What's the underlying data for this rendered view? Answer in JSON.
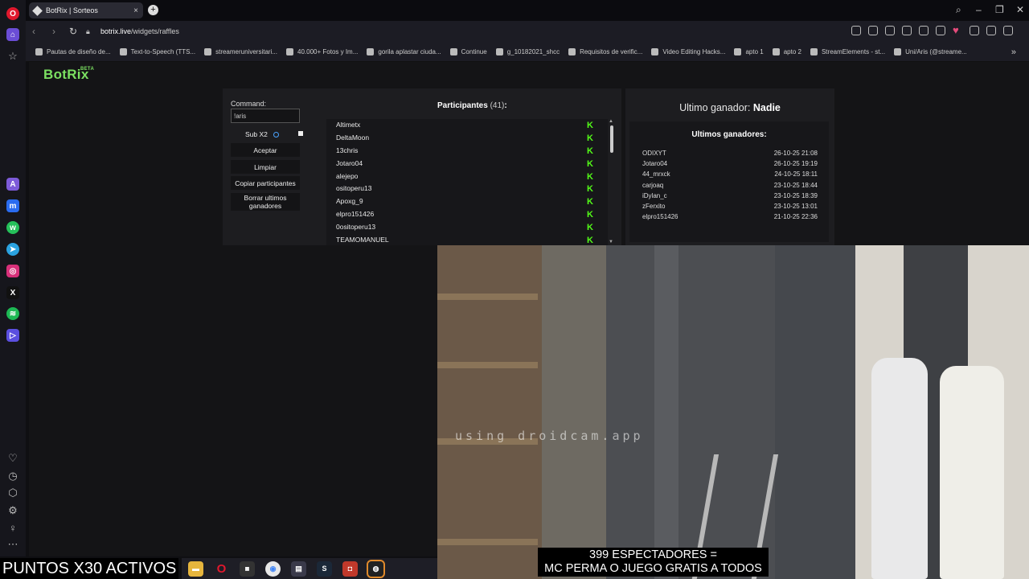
{
  "browser": {
    "tab_title": "BotRix | Sorteos",
    "url_host": "botrix.live",
    "url_path": "/widgets/raffles",
    "bookmarks": [
      "Pautas de diseño de...",
      "Text-to-Speech (TTS...",
      "streameruniversitari...",
      "40.000+ Fotos y Im...",
      "gorila aplastar ciuda...",
      "Continue",
      "g_10182021_shcc",
      "Requisitos de verific...",
      "Video Editing Hacks...",
      "apto 1",
      "apto 2",
      "StreamElements - st...",
      "Uni/Aris (@streame..."
    ]
  },
  "app": {
    "logo": "BotRix",
    "logo_badge": "BETA"
  },
  "controls": {
    "command_label": "Command:",
    "command_value": "!aris",
    "sub_label": "Sub X2",
    "accept": "Aceptar",
    "clear": "Limpiar",
    "copy": "Copiar participantes",
    "delete_winners": "Borrar ultimos ganadores"
  },
  "participants": {
    "title": "Participantes",
    "count": "(41)",
    "suffix": ":",
    "list": [
      "Altimetx",
      "DeltaMoon",
      "13chris",
      "Jotaro04",
      "alejepo",
      "ositoperu13",
      "Apoxg_9",
      "elpro151426",
      "0ositoperu13",
      "TEAMOMANUEL"
    ]
  },
  "winners": {
    "last_label": "Ultimo ganador:",
    "last_name": "Nadie",
    "title": "Ultimos ganadores:",
    "list": [
      {
        "name": "ODIXYT",
        "date": "26-10-25 21:08"
      },
      {
        "name": "Jotaro04",
        "date": "26-10-25 19:19"
      },
      {
        "name": "44_mrxck",
        "date": "24-10-25 18:11"
      },
      {
        "name": "carjoaq",
        "date": "23-10-25 18:44"
      },
      {
        "name": "iDylan_c",
        "date": "23-10-25 18:39"
      },
      {
        "name": "zFerxito",
        "date": "23-10-25 13:01"
      },
      {
        "name": "elpro151426",
        "date": "21-10-25 22:36"
      }
    ]
  },
  "overlay": {
    "watermark": "using droidcam.app",
    "caption_line1": "399 ESPECTADORES =",
    "caption_line2": "MC PERMA O JUEGO GRATIS A TODOS",
    "puntos": "PUNTOS X30 ACTIVOS"
  },
  "colors": {
    "accent": "#7be061",
    "kick": "#53fc18",
    "panel": "#1d1d20"
  }
}
